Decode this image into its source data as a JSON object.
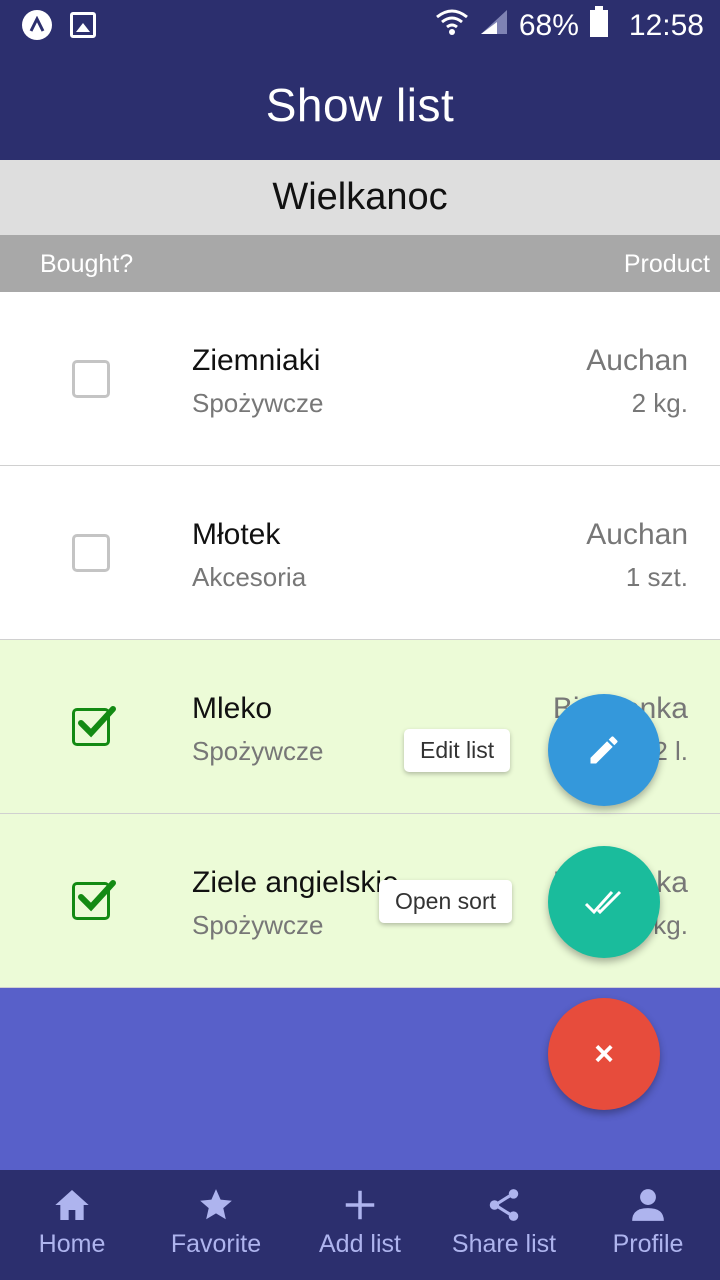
{
  "status_bar": {
    "battery": "68%",
    "time": "12:58"
  },
  "header": {
    "title": "Show list"
  },
  "list": {
    "name": "Wielkanoc"
  },
  "columns": {
    "left": "Bought?",
    "right": "Product"
  },
  "items": [
    {
      "name": "Ziemniaki",
      "category": "Spożywcze",
      "shop": "Auchan",
      "qty": "2 kg.",
      "bought": false
    },
    {
      "name": "Młotek",
      "category": "Akcesoria",
      "shop": "Auchan",
      "qty": "1 szt.",
      "bought": false
    },
    {
      "name": "Mleko",
      "category": "Spożywcze",
      "shop": "Biedronka",
      "qty": "2 l.",
      "bought": true
    },
    {
      "name": "Ziele angielskie",
      "category": "Spożywcze",
      "shop": "Biedronka",
      "qty": "1 kg.",
      "bought": true
    }
  ],
  "fab": {
    "edit_label": "Edit list",
    "sort_label": "Open sort",
    "close_symbol": "×"
  },
  "nav": [
    {
      "label": "Home",
      "icon": "home-icon"
    },
    {
      "label": "Favorite",
      "icon": "star-icon"
    },
    {
      "label": "Add list",
      "icon": "plus-icon"
    },
    {
      "label": "Share list",
      "icon": "share-icon"
    },
    {
      "label": "Profile",
      "icon": "person-icon"
    }
  ],
  "colors": {
    "primary": "#2c2f6e",
    "background": "#5860c9",
    "bought_row": "#ecfbd7",
    "edit_fab": "#3498db",
    "sort_fab": "#1abc9c",
    "close_fab": "#e74c3c",
    "nav_text": "#aeb4ee"
  }
}
